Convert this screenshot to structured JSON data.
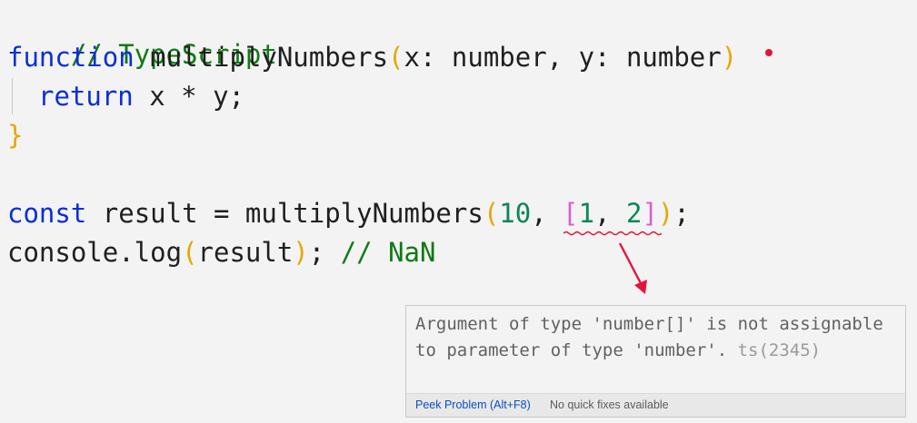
{
  "editor": {
    "lines": [
      {
        "comment": "// TypeScript"
      },
      {
        "kw": "function",
        "name": " multiplyNumbers",
        "open_paren": "(",
        "params": "x: number, y: number",
        "close_paren": ")"
      },
      {
        "kw": "return",
        "rest": " x * y;"
      },
      {
        "brace": "}"
      },
      {
        "kw": "const",
        "mid": " result = multiplyNumbers",
        "open_paren": "(",
        "arg1": "10",
        "comma": ", ",
        "open_bracket": "[",
        "el1": "1",
        "el_sep": ", ",
        "el2": "2",
        "close_bracket": "]",
        "close_paren": ")",
        "semi": ";"
      },
      {
        "obj": "console.log",
        "open_paren": "(",
        "arg": "result",
        "close_paren": ")",
        "semi": "; ",
        "comment": "// NaN"
      }
    ]
  },
  "hover": {
    "message": "Argument of type 'number[]' is not assignable to parameter of type 'number'.",
    "code": " ts(2345)",
    "peek_problem_label": "Peek Problem (Alt+F8)",
    "no_quick_fixes_label": "No quick fixes available"
  },
  "colors": {
    "comment": "#0f7a14",
    "keyword": "#0a2fd6",
    "number": "#098658",
    "paren": "#e6a700",
    "bracket": "#d85fd0",
    "error": "#e5133a",
    "link": "#0a4fbf"
  }
}
